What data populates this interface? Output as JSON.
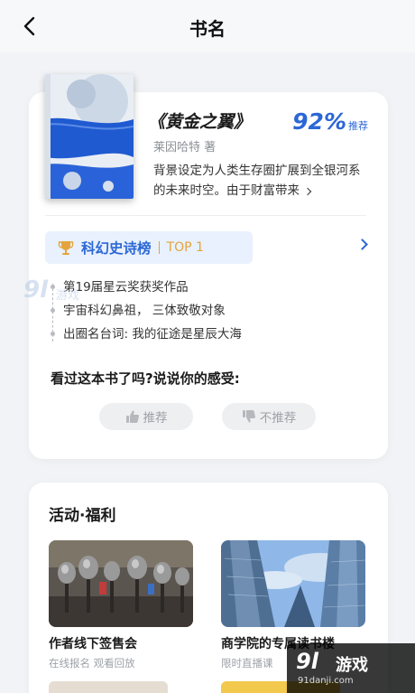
{
  "header": {
    "title": "书名"
  },
  "book": {
    "title": "《黄金之翼》",
    "author": "莱因哈特 著",
    "rating": "92%",
    "rating_label": "推荐",
    "description": "背景设定为人类生存圈扩展到全银河系的未来时空。由于财富带来"
  },
  "ranking": {
    "name": "科幻史诗榜",
    "position": "TOP 1"
  },
  "facts": [
    "第19届星云奖获奖作品",
    "宇宙科幻鼻祖， 三体致敬对象",
    "出圈名台词: 我的征途是星辰大海"
  ],
  "feedback": {
    "prompt": "看过这本书了吗?说说你的感受:",
    "recommend": "推荐",
    "not_recommend": "不推荐"
  },
  "activities": {
    "title": "活动·福利",
    "items": [
      {
        "name": "作者线下签售会",
        "sub": "在线报名 观看回放"
      },
      {
        "name": "商学院的专属读书楼",
        "sub": "限时直播课"
      }
    ]
  },
  "watermark": {
    "logo": "9l",
    "name": "游戏",
    "url": "91danji.com",
    "left_logo": "9l",
    "left_text": "游戏"
  },
  "colors": {
    "accent": "#2c67d6",
    "gold": "#e4a43c",
    "background": "#f1f3f6"
  }
}
